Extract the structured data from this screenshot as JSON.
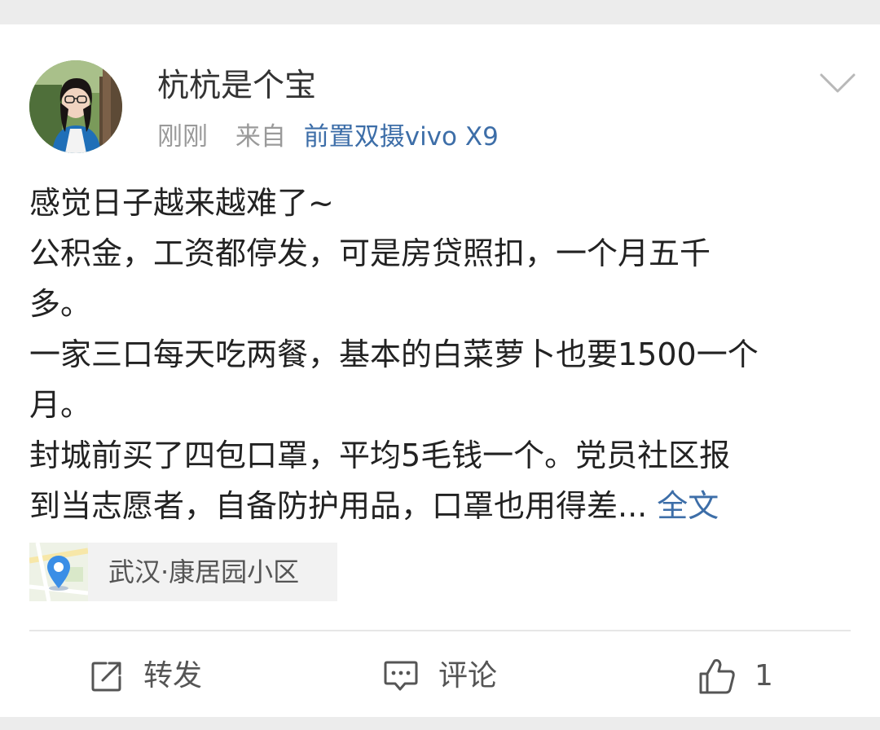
{
  "post": {
    "author": {
      "name": "杭杭是个宝"
    },
    "meta": {
      "time": "刚刚",
      "from_label": "来自",
      "device": "前置双摄vivo X9"
    },
    "text_lines": [
      "感觉日子越来越难了~",
      "公积金，工资都停发，可是房贷照扣，一个月五千",
      "多。",
      "一家三口每天吃两餐，基本的白菜萝卜也要1500一个",
      "月。",
      "封城前买了四包口罩，平均5毛钱一个。党员社区报",
      "到当志愿者，自备防护用品，口罩也用得差..."
    ],
    "full_text_link": "全文",
    "location": {
      "label": "武汉·康居园小区",
      "icon": "location-pin-icon"
    }
  },
  "actions": {
    "repost": {
      "label": "转发",
      "icon": "repost-icon"
    },
    "comment": {
      "label": "评论",
      "icon": "comment-icon"
    },
    "like": {
      "label": "1",
      "icon": "thumbs-up-icon"
    }
  },
  "colors": {
    "link": "#3d6ea8",
    "meta": "#9a9a9a",
    "text": "#222222",
    "background": "#ececec",
    "card": "#ffffff",
    "location_bg": "#f2f2f2",
    "pin": "#3a8ee6"
  }
}
